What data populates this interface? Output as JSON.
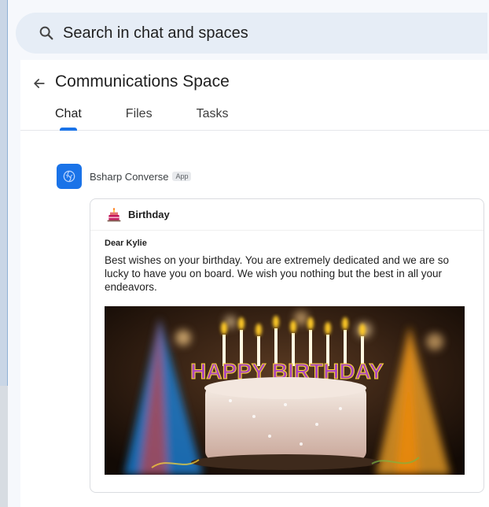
{
  "search": {
    "text": "Search in chat and spaces"
  },
  "header": {
    "title": "Communications Space",
    "tabs": [
      {
        "label": "Chat",
        "active": true
      },
      {
        "label": "Files",
        "active": false
      },
      {
        "label": "Tasks",
        "active": false
      }
    ]
  },
  "message": {
    "sender": "Bsharp Converse",
    "badge": "App",
    "card": {
      "title": "Birthday",
      "greeting": "Dear Kylie",
      "body": "Best wishes on your birthday. You are extremely dedicated and we are so lucky to have you on board. We wish you nothing but the best in all your endeavors.",
      "image_text": "HAPPY BIRTHDAY"
    }
  },
  "colors": {
    "accent": "#1a73e8",
    "search_bg": "#e6edf6"
  },
  "icons": {
    "search": "search-icon",
    "back": "arrow-left-icon",
    "avatar": "brain-icon",
    "card": "cake-icon"
  }
}
